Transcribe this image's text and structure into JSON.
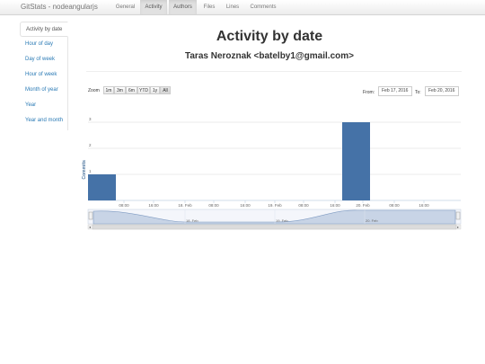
{
  "navbar": {
    "brand": "GitStats - nodeangularjs",
    "items": [
      {
        "label": "General",
        "active": false
      },
      {
        "label": "Activity",
        "active": true
      },
      {
        "label": "Authors",
        "active": true
      },
      {
        "label": "Files",
        "active": false
      },
      {
        "label": "Lines",
        "active": false
      },
      {
        "label": "Comments",
        "active": false
      }
    ]
  },
  "sidebar": {
    "items": [
      {
        "label": "Activity by date",
        "active": true
      },
      {
        "label": "Hour of day",
        "active": false
      },
      {
        "label": "Day of week",
        "active": false
      },
      {
        "label": "Hour of week",
        "active": false
      },
      {
        "label": "Month of year",
        "active": false
      },
      {
        "label": "Year",
        "active": false
      },
      {
        "label": "Year and month",
        "active": false
      }
    ]
  },
  "main": {
    "title": "Activity by date",
    "author": "Taras Neroznak <batelby1@gmail.com>"
  },
  "zoom": {
    "label": "Zoom",
    "buttons": [
      "1m",
      "3m",
      "6m",
      "YTD",
      "1y",
      "All"
    ]
  },
  "range": {
    "from_label": "From:",
    "from_value": "Feb 17, 2016",
    "to_label": "To:",
    "to_value": "Feb 20, 2016"
  },
  "colors": {
    "bar": "#4572a7",
    "navigator_fill": "#c8d4e6",
    "navigator_line": "#7f9bc2"
  },
  "chart_data": {
    "type": "bar",
    "ylabel": "Commits",
    "ylim": [
      0,
      3
    ],
    "y_ticks": [
      "1",
      "2",
      "3"
    ],
    "x_tick_labels": [
      "08:00",
      "16:00",
      "18. Feb",
      "08:00",
      "16:00",
      "19. Feb",
      "08:00",
      "16:00",
      "20. Feb",
      "08:00",
      "16:00"
    ],
    "bars": [
      {
        "x": "17. Feb 00:00",
        "value": 1
      },
      {
        "x": "20. Feb 00:00",
        "value": 3
      }
    ],
    "navigator_labels": [
      "18. Feb",
      "19. Feb",
      "20. Feb"
    ]
  }
}
